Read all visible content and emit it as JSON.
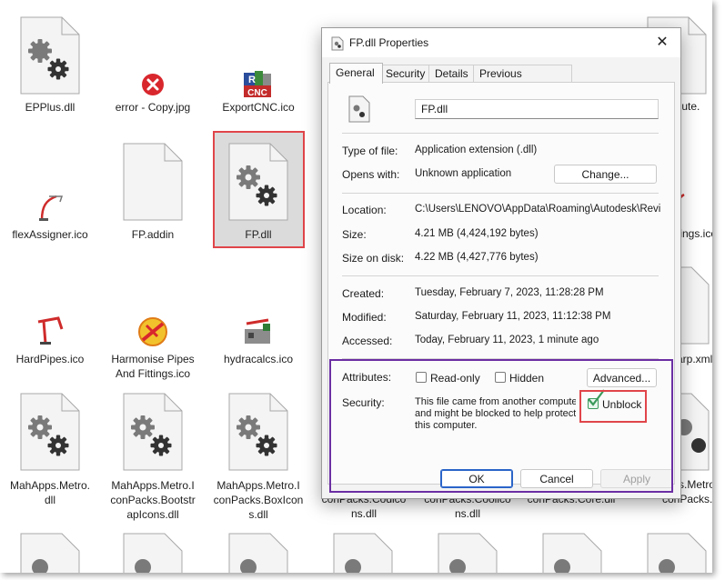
{
  "explorer": {
    "files": [
      {
        "label": "EPPlus.dll",
        "icon": "dll-gear-icon"
      },
      {
        "label": "error - Copy.jpg",
        "icon": "error-icon"
      },
      {
        "label": "ExportCNC.ico",
        "icon": "cnc-icon"
      },
      {
        "label": "flexAssigner.ico",
        "icon": "crane-icon"
      },
      {
        "label": "FP.addin",
        "icon": "blank-file-icon"
      },
      {
        "label": "FP.dll",
        "icon": "dll-gear-icon"
      },
      {
        "label": "HardPipes.ico",
        "icon": "pipe-icon"
      },
      {
        "label": "Harmonise Pipes And Fittings.ico",
        "icon": "harmonise-icon"
      },
      {
        "label": "hydracalcs.ico",
        "icon": "hydra-icon"
      },
      {
        "label": "MahApps.Metro.dll",
        "icon": "dll-gear-icon"
      },
      {
        "label": "MahApps.Metro.IconPacks.BootstrapIcons.dll",
        "icon": "dll-gear-icon"
      },
      {
        "label": "MahApps.Metro.IconPacks.BoxIcons.dll",
        "icon": "dll-gear-icon"
      },
      {
        "label": "conPacks.Codicons.dll",
        "icon": "dll-gear-icon"
      },
      {
        "label": "conPacks.Coolicons.dll",
        "icon": "dll-gear-icon"
      },
      {
        "label": "conPacks.Core.dll",
        "icon": "dll-gear-icon"
      },
      {
        "label": "MahApps.Metro.IconPacks.",
        "icon": "dll-gear-icon"
      },
      {
        "label": "tings.ico",
        "icon": "crane-icon"
      },
      {
        "label": "arp.xml",
        "icon": "blank-file-icon"
      },
      {
        "label": "canute.",
        "icon": "blank-file-icon"
      }
    ],
    "split_labels": {
      "epplus": "EPPlus.dll",
      "error": "error - Copy.jpg",
      "exportcnc": "ExportCNC.ico",
      "flex": "flexAssigner.ico",
      "fpaddin": "FP.addin",
      "fpdll": "FP.dll",
      "hardpipes": "HardPipes.ico",
      "harmonise_1": "Harmonise Pipes",
      "harmonise_2": "And Fittings.ico",
      "hydra": "hydracalcs.ico",
      "mah_1": "MahApps.Metro.",
      "mah_2": "dll",
      "boot_1": "MahApps.Metro.I",
      "boot_2": "conPacks.Bootstr",
      "boot_3": "apIcons.dll",
      "box_1": "MahApps.Metro.I",
      "box_2": "conPacks.BoxIcon",
      "box_3": "s.dll",
      "codi_1": "conPacks.Codico",
      "codi_2": "ns.dll",
      "cool_1": "conPacks.Coolico",
      "cool_2": "ns.dll",
      "core_1": "conPacks.Core.dll",
      "right_1": "canute.",
      "right_2": "tings.ico",
      "right_3": "arp.xml",
      "right_4": "s.Metro",
      "right_5": "conPacks."
    }
  },
  "dialog": {
    "title": "FP.dll Properties",
    "close_glyph": "✕",
    "tabs": [
      "General",
      "Security",
      "Details",
      "Previous Versions"
    ],
    "filename": "FP.dll",
    "type_label": "Type of file:",
    "type_value": "Application extension (.dll)",
    "opens_label": "Opens with:",
    "opens_value": "Unknown application",
    "change_button": "Change...",
    "location_label": "Location:",
    "location_value": "C:\\Users\\LENOVO\\AppData\\Roaming\\Autodesk\\Revit\\",
    "size_label": "Size:",
    "size_value": "4.21 MB (4,424,192 bytes)",
    "size_on_disk_label": "Size on disk:",
    "size_on_disk_value": "4.22 MB (4,427,776 bytes)",
    "created_label": "Created:",
    "created_value": "Tuesday, February 7, 2023, 11:28:28 PM",
    "modified_label": "Modified:",
    "modified_value": "Saturday, February 11, 2023, 11:12:38 PM",
    "accessed_label": "Accessed:",
    "accessed_value": "Today, February 11, 2023, 1 minute ago",
    "attributes_label": "Attributes:",
    "readonly_label": "Read-only",
    "hidden_label": "Hidden",
    "advanced_button": "Advanced...",
    "security_label": "Security:",
    "security_line1": "This file came from another computer",
    "security_line2": "and might be blocked to help protect",
    "security_line3": "this computer.",
    "unblock_label": "Unblock",
    "ok_button": "OK",
    "cancel_button": "Cancel",
    "apply_button": "Apply"
  },
  "colors": {
    "highlight_red": "#e0454a",
    "highlight_purple": "#6b2ea3",
    "checkbox_green": "#3a9a5b"
  }
}
